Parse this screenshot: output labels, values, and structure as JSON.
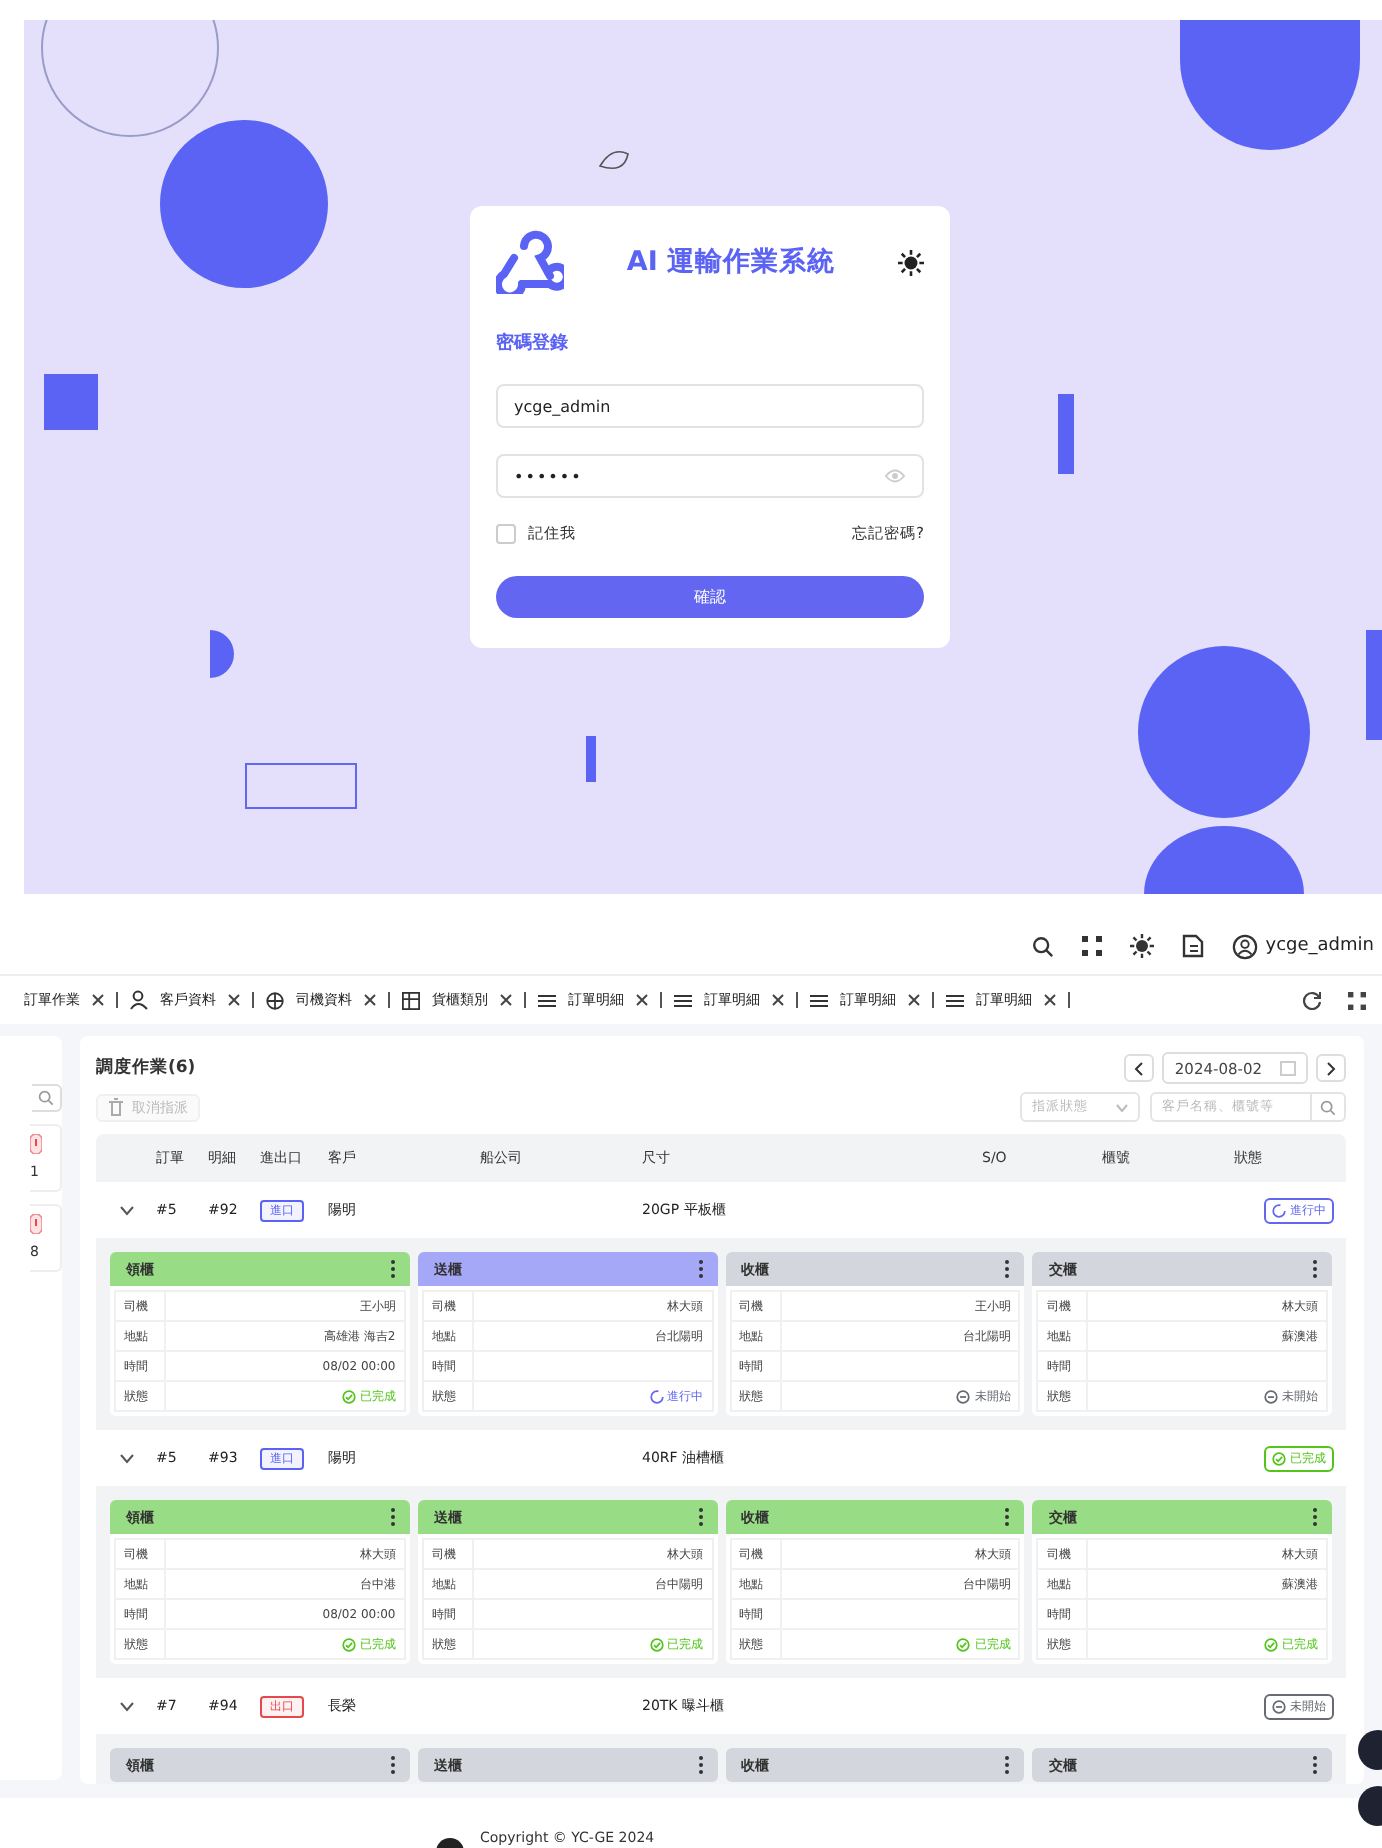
{
  "login": {
    "title": "AI 運輸作業系統",
    "heading": "密碼登錄",
    "username": "ycge_admin",
    "password": "••••••",
    "remember": {
      "label": "記住我",
      "checked": false
    },
    "forgot": "忘記密碼?",
    "submit": "確認"
  },
  "topbar": {
    "user": "ycge_admin"
  },
  "tabs": [
    {
      "label": "訂單作業",
      "kind": "plain"
    },
    {
      "label": "客戶資料",
      "kind": "person"
    },
    {
      "label": "司機資料",
      "kind": "globe"
    },
    {
      "label": "貨櫃類別",
      "kind": "grid"
    },
    {
      "label": "訂單明細",
      "kind": "list"
    },
    {
      "label": "訂單明細",
      "kind": "list"
    },
    {
      "label": "訂單明細",
      "kind": "list"
    },
    {
      "label": "訂單明細",
      "kind": "list"
    }
  ],
  "sidebar": {
    "items": [
      {
        "count": "1"
      },
      {
        "count": "8"
      }
    ]
  },
  "main": {
    "title": "調度作業(6)",
    "cancel_button": {
      "label": "取消指派",
      "disabled": true
    },
    "date": "2024-08-02",
    "status_filter": {
      "placeholder": "指派狀態"
    },
    "search": {
      "placeholder": "客戶名稱、櫃號等"
    },
    "columns": [
      "訂單",
      "明細",
      "進出口",
      "客戶",
      "船公司",
      "尺寸",
      "S/O",
      "櫃號",
      "狀態"
    ],
    "orders": [
      {
        "order": "#5",
        "detail": "#92",
        "io": {
          "label": "進口",
          "color": "#5b63f5"
        },
        "customer": "陽明",
        "size": "20GP 平板櫃",
        "kind": "active",
        "status_label": "進行中",
        "expanded": true,
        "stages": [
          {
            "title": "領櫃",
            "kind": "done",
            "rows": [
              {
                "label": "司機",
                "value": "王小明"
              },
              {
                "label": "地點",
                "value": "高雄港 海吉2"
              },
              {
                "label": "時間",
                "value": "08/02 00:00"
              },
              {
                "label": "狀態",
                "value": "已完成"
              }
            ]
          },
          {
            "title": "送櫃",
            "kind": "active",
            "rows": [
              {
                "label": "司機",
                "value": "林大頭"
              },
              {
                "label": "地點",
                "value": "台北陽明"
              },
              {
                "label": "時間"
              },
              {
                "label": "狀態",
                "value": "進行中"
              }
            ]
          },
          {
            "title": "收櫃",
            "kind": "pending",
            "rows": [
              {
                "label": "司機",
                "value": "王小明"
              },
              {
                "label": "地點",
                "value": "台北陽明"
              },
              {
                "label": "時間"
              },
              {
                "label": "狀態",
                "value": "未開始"
              }
            ]
          },
          {
            "title": "交櫃",
            "kind": "pending",
            "rows": [
              {
                "label": "司機",
                "value": "林大頭"
              },
              {
                "label": "地點",
                "value": "蘇澳港"
              },
              {
                "label": "時間"
              },
              {
                "label": "狀態",
                "value": "未開始"
              }
            ]
          }
        ]
      },
      {
        "order": "#5",
        "detail": "#93",
        "io": {
          "label": "進口",
          "color": "#5b63f5"
        },
        "customer": "陽明",
        "size": "40RF 油槽櫃",
        "kind": "done",
        "status_label": "已完成",
        "expanded": true,
        "stages": [
          {
            "title": "領櫃",
            "kind": "done",
            "rows": [
              {
                "label": "司機",
                "value": "林大頭"
              },
              {
                "label": "地點",
                "value": "台中港"
              },
              {
                "label": "時間",
                "value": "08/02 00:00"
              },
              {
                "label": "狀態",
                "value": "已完成"
              }
            ]
          },
          {
            "title": "送櫃",
            "kind": "done",
            "rows": [
              {
                "label": "司機",
                "value": "林大頭"
              },
              {
                "label": "地點",
                "value": "台中陽明"
              },
              {
                "label": "時間"
              },
              {
                "label": "狀態",
                "value": "已完成"
              }
            ]
          },
          {
            "title": "收櫃",
            "kind": "done",
            "rows": [
              {
                "label": "司機",
                "value": "林大頭"
              },
              {
                "label": "地點",
                "value": "台中陽明"
              },
              {
                "label": "時間"
              },
              {
                "label": "狀態",
                "value": "已完成"
              }
            ]
          },
          {
            "title": "交櫃",
            "kind": "done",
            "rows": [
              {
                "label": "司機",
                "value": "林大頭"
              },
              {
                "label": "地點",
                "value": "蘇澳港"
              },
              {
                "label": "時間"
              },
              {
                "label": "狀態",
                "value": "已完成"
              }
            ]
          }
        ]
      },
      {
        "order": "#7",
        "detail": "#94",
        "io": {
          "label": "出口",
          "color": "#e5484d"
        },
        "customer": "長榮",
        "size": "20TK 曝斗櫃",
        "kind": "pending",
        "status_label": "未開始",
        "expanded": true,
        "stages": [
          {
            "title": "領櫃",
            "kind": "pending"
          },
          {
            "title": "送櫃",
            "kind": "pending"
          },
          {
            "title": "收櫃",
            "kind": "pending"
          },
          {
            "title": "交櫃",
            "kind": "pending"
          }
        ]
      }
    ]
  },
  "footer": {
    "copyright": "Copyright © YC-GE 2024"
  }
}
